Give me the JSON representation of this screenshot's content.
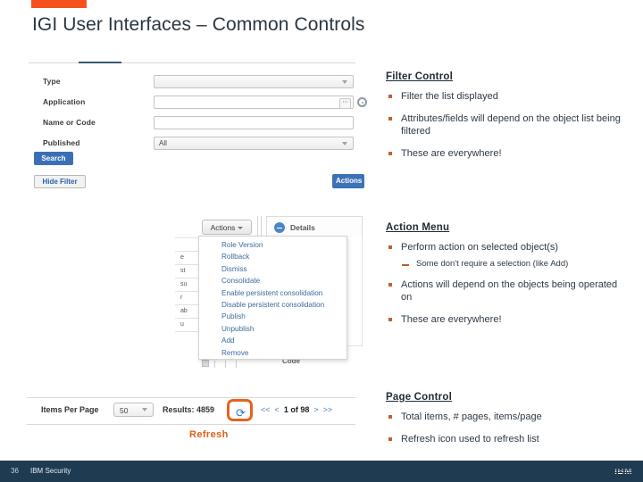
{
  "slide": {
    "title": "IGI User Interfaces – Common Controls",
    "accent_color": "#f4511e"
  },
  "filter_panel": {
    "fields": [
      {
        "label": "Type",
        "value": "",
        "control": "select"
      },
      {
        "label": "Application",
        "value": "",
        "control": "lookup"
      },
      {
        "label": "Name or Code",
        "value": "",
        "control": "text"
      },
      {
        "label": "Published",
        "value": "All",
        "control": "select"
      }
    ],
    "search_button": "Search",
    "hide_filter_button": "Hide Filter",
    "actions_button": "Actions"
  },
  "action_menu_shot": {
    "actions_button": "Actions",
    "details_label": "Details",
    "code_label": "Code",
    "items": [
      "Role Version",
      "Rollback",
      "Dismiss",
      "Consolidate",
      "Enable persistent consolidation",
      "Disable persistent consolidation",
      "Publish",
      "Unpublish",
      "Add",
      "Remove"
    ]
  },
  "page_control_shot": {
    "items_per_page_label": "Items Per Page",
    "items_per_page_value": "50",
    "results_label": "Results: 4859",
    "refresh_icon": "refresh-icon",
    "first_page": "<<",
    "prev_page": "<",
    "page_indicator": "1 of 98",
    "next_page": ">",
    "last_page": ">>",
    "refresh_caption": "Refresh",
    "highlight_color": "#e8621c"
  },
  "notes": {
    "filter": {
      "heading": "Filter Control",
      "bullets": [
        "Filter the list displayed",
        "Attributes/fields will depend on the object list being filtered",
        "These are everywhere!"
      ]
    },
    "action": {
      "heading": "Action Menu",
      "bullet1": "Perform action on selected object(s)",
      "sub1": "Some don't require a selection (like Add)",
      "bullet2": "Actions will depend on the objects being operated on",
      "bullet3": "These are everywhere!"
    },
    "page": {
      "heading": "Page Control",
      "bullets": [
        "Total items, # pages, items/page",
        "Refresh icon used to refresh list"
      ]
    }
  },
  "footer": {
    "number": "36",
    "text": "IBM Security",
    "logo": "IBM"
  }
}
